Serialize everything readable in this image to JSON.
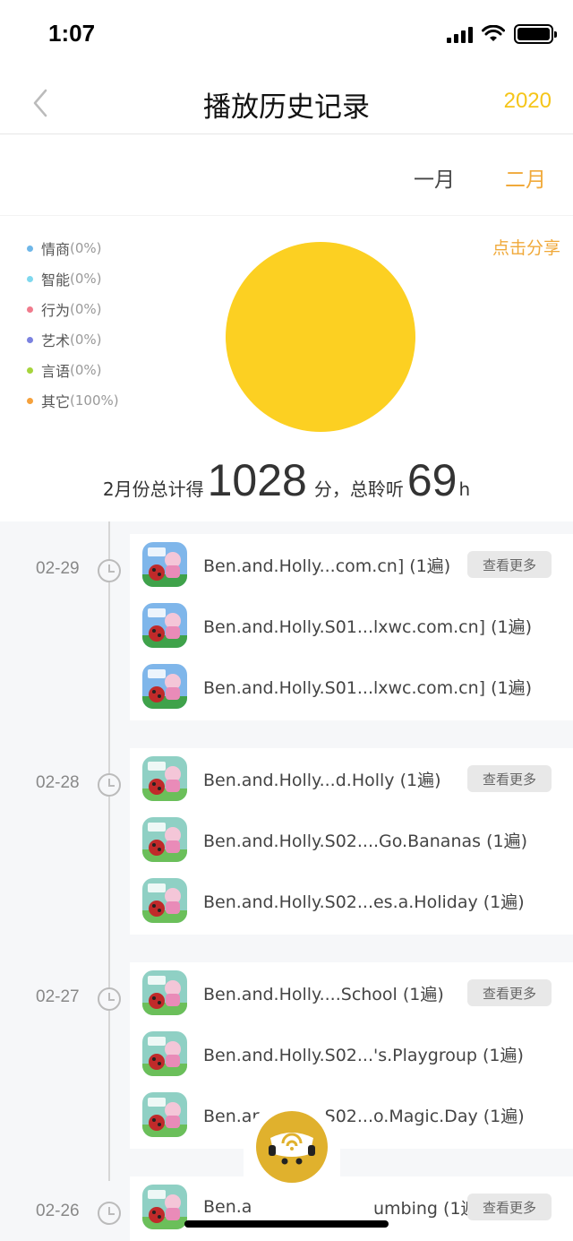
{
  "status_bar": {
    "time": "1:07"
  },
  "nav": {
    "title": "播放历史记录",
    "year": "2020"
  },
  "months": {
    "jan": "一月",
    "feb": "二月"
  },
  "stats": {
    "share_label": "点击分享",
    "legend": [
      {
        "label": "情商",
        "pct": "(0%)",
        "color": "#6fb7e8"
      },
      {
        "label": "智能",
        "pct": "(0%)",
        "color": "#7fd8ee"
      },
      {
        "label": "行为",
        "pct": "(0%)",
        "color": "#f07b8c"
      },
      {
        "label": "艺术",
        "pct": "(0%)",
        "color": "#7b82e0"
      },
      {
        "label": "言语",
        "pct": "(0%)",
        "color": "#a6d43c"
      },
      {
        "label": "其它",
        "pct": "(100%)",
        "color": "#f5a13c"
      }
    ],
    "pie_color": "#fcd022",
    "total_prefix": "2月份总计得",
    "score": "1028",
    "score_unit": "分，总聆听",
    "hours": "69",
    "hours_unit": "h"
  },
  "more_label": "查看更多",
  "history": [
    {
      "date": "02-29",
      "items": [
        {
          "title": "Ben.and.Holly...com.cn] (1遍)",
          "thumb": "a",
          "has_more": true
        },
        {
          "title": "Ben.and.Holly.S01...lxwc.com.cn] (1遍)",
          "thumb": "a",
          "has_more": false
        },
        {
          "title": "Ben.and.Holly.S01...lxwc.com.cn] (1遍)",
          "thumb": "a",
          "has_more": false
        }
      ]
    },
    {
      "date": "02-28",
      "items": [
        {
          "title": "Ben.and.Holly...d.Holly (1遍)",
          "thumb": "b",
          "has_more": true
        },
        {
          "title": "Ben.and.Holly.S02....Go.Bananas (1遍)",
          "thumb": "b",
          "has_more": false
        },
        {
          "title": "Ben.and.Holly.S02...es.a.Holiday (1遍)",
          "thumb": "b",
          "has_more": false
        }
      ]
    },
    {
      "date": "02-27",
      "items": [
        {
          "title": "Ben.and.Holly....School (1遍)",
          "thumb": "b",
          "has_more": true
        },
        {
          "title": "Ben.and.Holly.S02...'s.Playgroup (1遍)",
          "thumb": "b",
          "has_more": false
        },
        {
          "title": "Ben.and.Holly.S02...o.Magic.Day (1遍)",
          "thumb": "b",
          "has_more": false
        }
      ]
    },
    {
      "date": "02-26",
      "items": [
        {
          "title": "Ben.a",
          "title_tail": "umbing (1遍)",
          "thumb": "b",
          "has_more": true
        }
      ]
    }
  ]
}
